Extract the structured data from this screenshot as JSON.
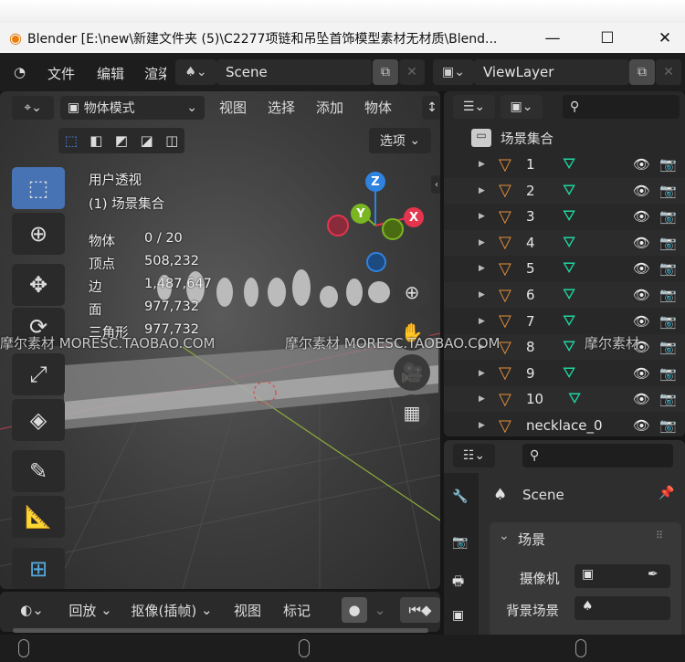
{
  "window": {
    "title": "Blender [E:\\new\\新建文件夹 (5)\\C2277项链和吊坠首饰模型素材无材质\\Blend...",
    "minimize": "—",
    "maximize": "☐",
    "close": "✕"
  },
  "menubar": {
    "items": [
      "文件",
      "编辑",
      "渲染"
    ],
    "scene": "Scene",
    "view_layer": "ViewLayer"
  },
  "viewport": {
    "mode": "物体模式",
    "menus": [
      "视图",
      "选择",
      "添加",
      "物体"
    ],
    "options": "选项",
    "view_name": "用户透视",
    "collection": "(1) 场景集合",
    "stats": [
      {
        "label": "物体",
        "value": "0 / 20"
      },
      {
        "label": "顶点",
        "value": "508,232"
      },
      {
        "label": "边",
        "value": "1,487,647"
      },
      {
        "label": "面",
        "value": "977,732"
      },
      {
        "label": "三角形",
        "value": "977,732"
      }
    ],
    "axes": {
      "z": "Z",
      "y": "Y",
      "x": "X"
    }
  },
  "outliner": {
    "root": "场景集合",
    "items": [
      "1",
      "2",
      "3",
      "4",
      "5",
      "6",
      "7",
      "8",
      "9",
      "10",
      "necklace_0"
    ]
  },
  "properties": {
    "scene_name": "Scene",
    "panel": "场景",
    "camera_label": "摄像机",
    "background_label": "背景场景"
  },
  "timeline": {
    "playback": "回放",
    "keying": "抠像(插帧)",
    "view": "视图",
    "marker": "标记"
  },
  "watermark": [
    "摩尔素材 MORESC.TAOBAO.COM",
    "摩尔素材 MORESC.TAOBAO.COM",
    "摩尔素材"
  ],
  "colors": {
    "accent": "#4772b3",
    "object": "#e8913a",
    "mesh": "#1fd6a0",
    "x": "#e5344d",
    "y": "#7ab522",
    "z": "#2f83e0"
  }
}
